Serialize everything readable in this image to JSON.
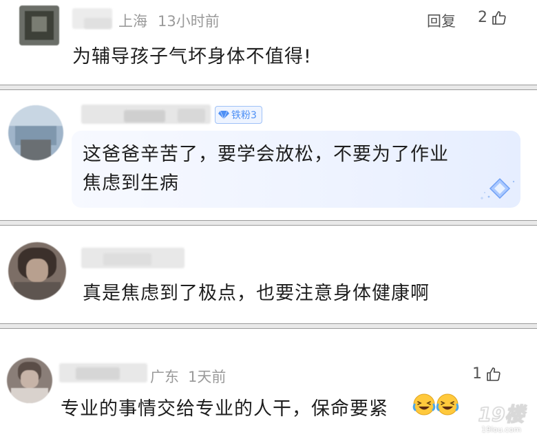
{
  "comments": [
    {
      "location": "上海",
      "time": "13小时前",
      "reply_label": "回复",
      "likes": "2",
      "content": "为辅导孩子气坏身体不值得!"
    },
    {
      "badge": "铁粉3",
      "line1": "这爸爸辛苦了，要学会放松，不要为了作业",
      "line2": "焦虑到生病"
    },
    {
      "content": "真是焦虑到了极点，也要注意身体健康啊"
    },
    {
      "location": "广东",
      "time": "1天前",
      "likes": "1",
      "content": "专业的事情交给专业的人干，保命要紧"
    }
  ],
  "watermark": {
    "main": "19楼",
    "sub": "19lou.com"
  },
  "colors": {
    "meta_gray": "#9a9a9a",
    "badge_blue": "#4d8ff5",
    "divider_gray": "#e9e9e9"
  }
}
